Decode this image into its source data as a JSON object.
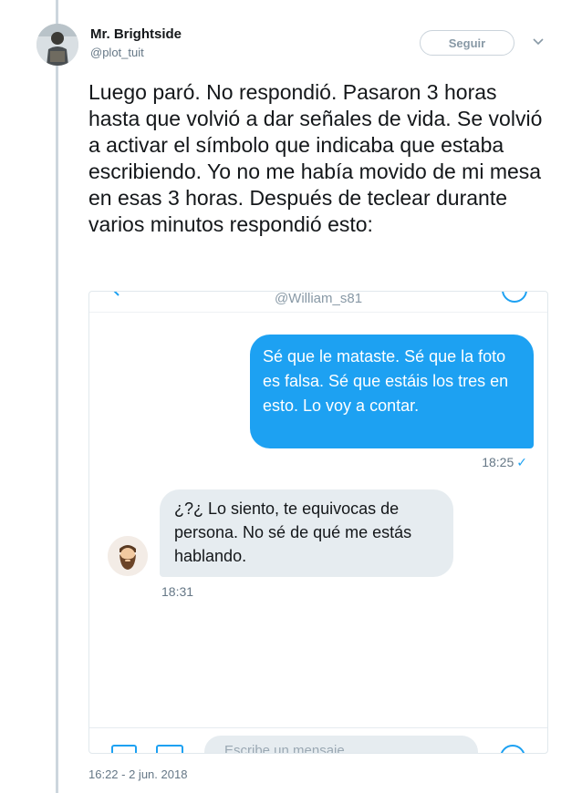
{
  "top_fragment": "",
  "author": {
    "display_name": "Mr. Brightside",
    "screen_name": "@plot_tuit",
    "avatar_icon": "avatar-photo-icon"
  },
  "follow_button": {
    "label": "Seguir"
  },
  "tweet": {
    "text": "Luego paró. No respondió. Pasaron 3 horas hasta que volvió a dar señales de vida. Se volvió a activar el símbolo que indicaba que estaba escribiendo. Yo no me había movido de mi mesa en esas 3 horas. Después de teclear durante varios minutos respondió esto:",
    "timestamp": "16:22 - 2 jun. 2018"
  },
  "dm_screenshot": {
    "contact_handle": "@William_s81",
    "sent_message": {
      "text": "Sé que le mataste. Sé que la foto es falsa. Sé que estáis los tres en esto. Lo voy a contar.",
      "time": "18:25",
      "read_mark": "✓"
    },
    "received_message": {
      "text": "¿?¿ Lo siento, te equivocas de persona. No sé de qué me estás hablando.",
      "time": "18:31",
      "avatar_icon": "bearded-man-avatar-icon"
    },
    "composer_placeholder": "Escribe un mensaje",
    "accent_color": "#1da1f2",
    "received_bubble_color": "#e6ecf0"
  }
}
